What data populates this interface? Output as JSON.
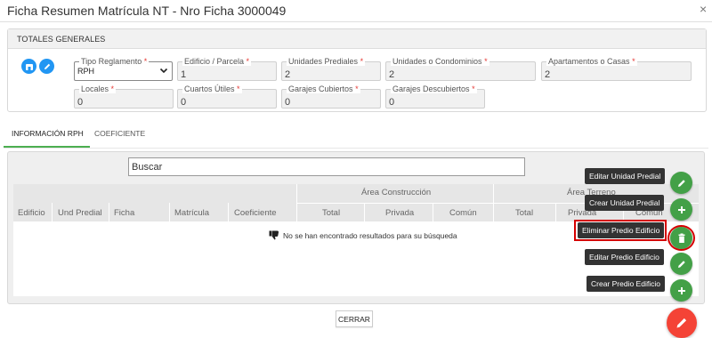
{
  "window": {
    "title": "Ficha Resumen Matrícula NT - Nro Ficha 3000049",
    "close_glyph": "×"
  },
  "totales": {
    "title": "TOTALES GENERALES",
    "fields": [
      {
        "label": "Tipo Reglamento",
        "value": "RPH",
        "required": "*"
      },
      {
        "label": "Edificio / Parcela",
        "value": "1",
        "required": "*"
      },
      {
        "label": "Unidades Prediales",
        "value": "2",
        "required": "*"
      },
      {
        "label": "Unidades o Condominios",
        "value": "2",
        "required": "*"
      },
      {
        "label": "Apartamentos o Casas",
        "value": "2",
        "required": "*"
      },
      {
        "label": "Locales",
        "value": "0",
        "required": "*"
      },
      {
        "label": "Cuartos Útiles",
        "value": "0",
        "required": "*"
      },
      {
        "label": "Garajes Cubiertos",
        "value": "0",
        "required": "*"
      },
      {
        "label": "Garajes Descubiertos",
        "value": "0",
        "required": "*"
      }
    ]
  },
  "tabs": [
    {
      "label": "INFORMACIÓN RPH"
    },
    {
      "label": "COEFICIENTE"
    }
  ],
  "table": {
    "search_placeholder": "Buscar",
    "group_area_construccion": "Área Construcción",
    "group_area_terreno": "Área Terreno",
    "columns": [
      "Edificio",
      "Und Predial",
      "Ficha",
      "Matrícula",
      "Coeficiente",
      "Total",
      "Privada",
      "Común",
      "Total",
      "Privada",
      "Común"
    ],
    "empty_message": "No se han encontrado resultados para su búsqueda"
  },
  "actions": {
    "editar_unidad": "Editar Unidad Predial",
    "crear_unidad": "Crear Unidad Predial",
    "eliminar_predio": "Eliminar Predio Edificio",
    "editar_predio": "Editar Predio Edificio",
    "crear_predio": "Crear Predio Edificio"
  },
  "footer": {
    "cerrar": "CERRAR"
  },
  "colors": {
    "accent_blue": "#2196f3",
    "fab_green": "#43a047",
    "fab_red": "#f44336",
    "tab_green": "#4caf50",
    "highlight_red": "#d50000"
  },
  "icons": [
    "home-icon",
    "pencil-icon",
    "chevron-down-icon",
    "thumbs-down-icon",
    "plus-icon",
    "trash-icon",
    "close-icon"
  ]
}
